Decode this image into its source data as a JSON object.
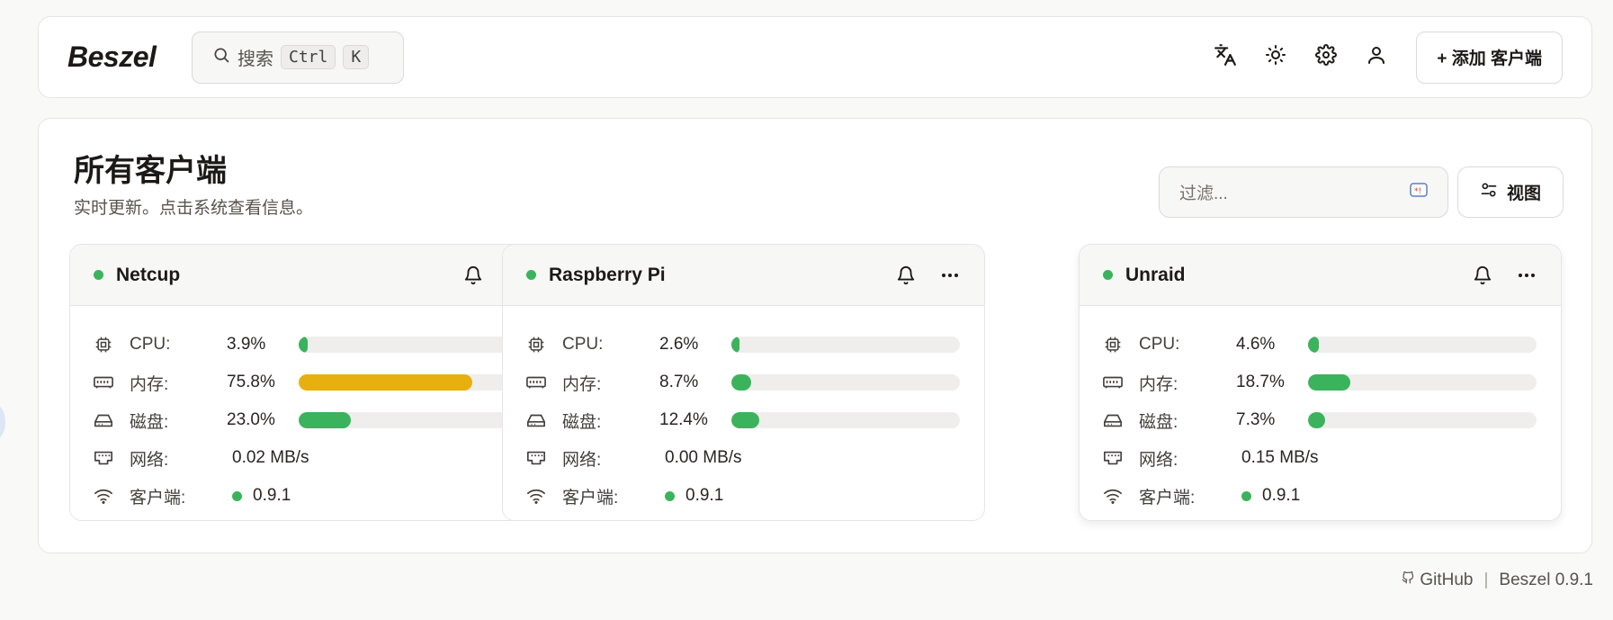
{
  "header": {
    "logo": "Beszel",
    "search": {
      "label": "搜索",
      "kbd1": "Ctrl",
      "kbd2": "K"
    },
    "icons": [
      "translate-icon",
      "sun-icon",
      "gear-icon",
      "user-icon"
    ],
    "add_button": "+ 添加 客户端"
  },
  "main": {
    "title": "所有客户端",
    "subtitle": "实时更新。点击系统查看信息。",
    "filter_placeholder": "过滤...",
    "view_button": "视图"
  },
  "labels": {
    "cpu": "CPU:",
    "mem": "内存:",
    "disk": "磁盘:",
    "net": "网络:",
    "agent": "客户端:"
  },
  "systems": [
    {
      "name": "Netcup",
      "status": "up",
      "cpu": "3.9%",
      "cpu_pct": 3.9,
      "mem": "75.8%",
      "mem_pct": 75.8,
      "disk": "23.0%",
      "disk_pct": 23.0,
      "net": "0.02 MB/s",
      "agent": "0.9.1"
    },
    {
      "name": "Raspberry Pi",
      "status": "up",
      "cpu": "2.6%",
      "cpu_pct": 2.6,
      "mem": "8.7%",
      "mem_pct": 8.7,
      "disk": "12.4%",
      "disk_pct": 12.4,
      "net": "0.00 MB/s",
      "agent": "0.9.1"
    },
    {
      "name": "Unraid",
      "status": "up",
      "cpu": "4.6%",
      "cpu_pct": 4.6,
      "mem": "18.7%",
      "mem_pct": 18.7,
      "disk": "7.3%",
      "disk_pct": 7.3,
      "net": "0.15 MB/s",
      "agent": "0.9.1"
    }
  ],
  "colors": {
    "ok": "#3bb35d",
    "warn": "#e7b00f",
    "track": "#efeeec"
  },
  "footer": {
    "github": "GitHub",
    "version": "Beszel 0.9.1"
  }
}
